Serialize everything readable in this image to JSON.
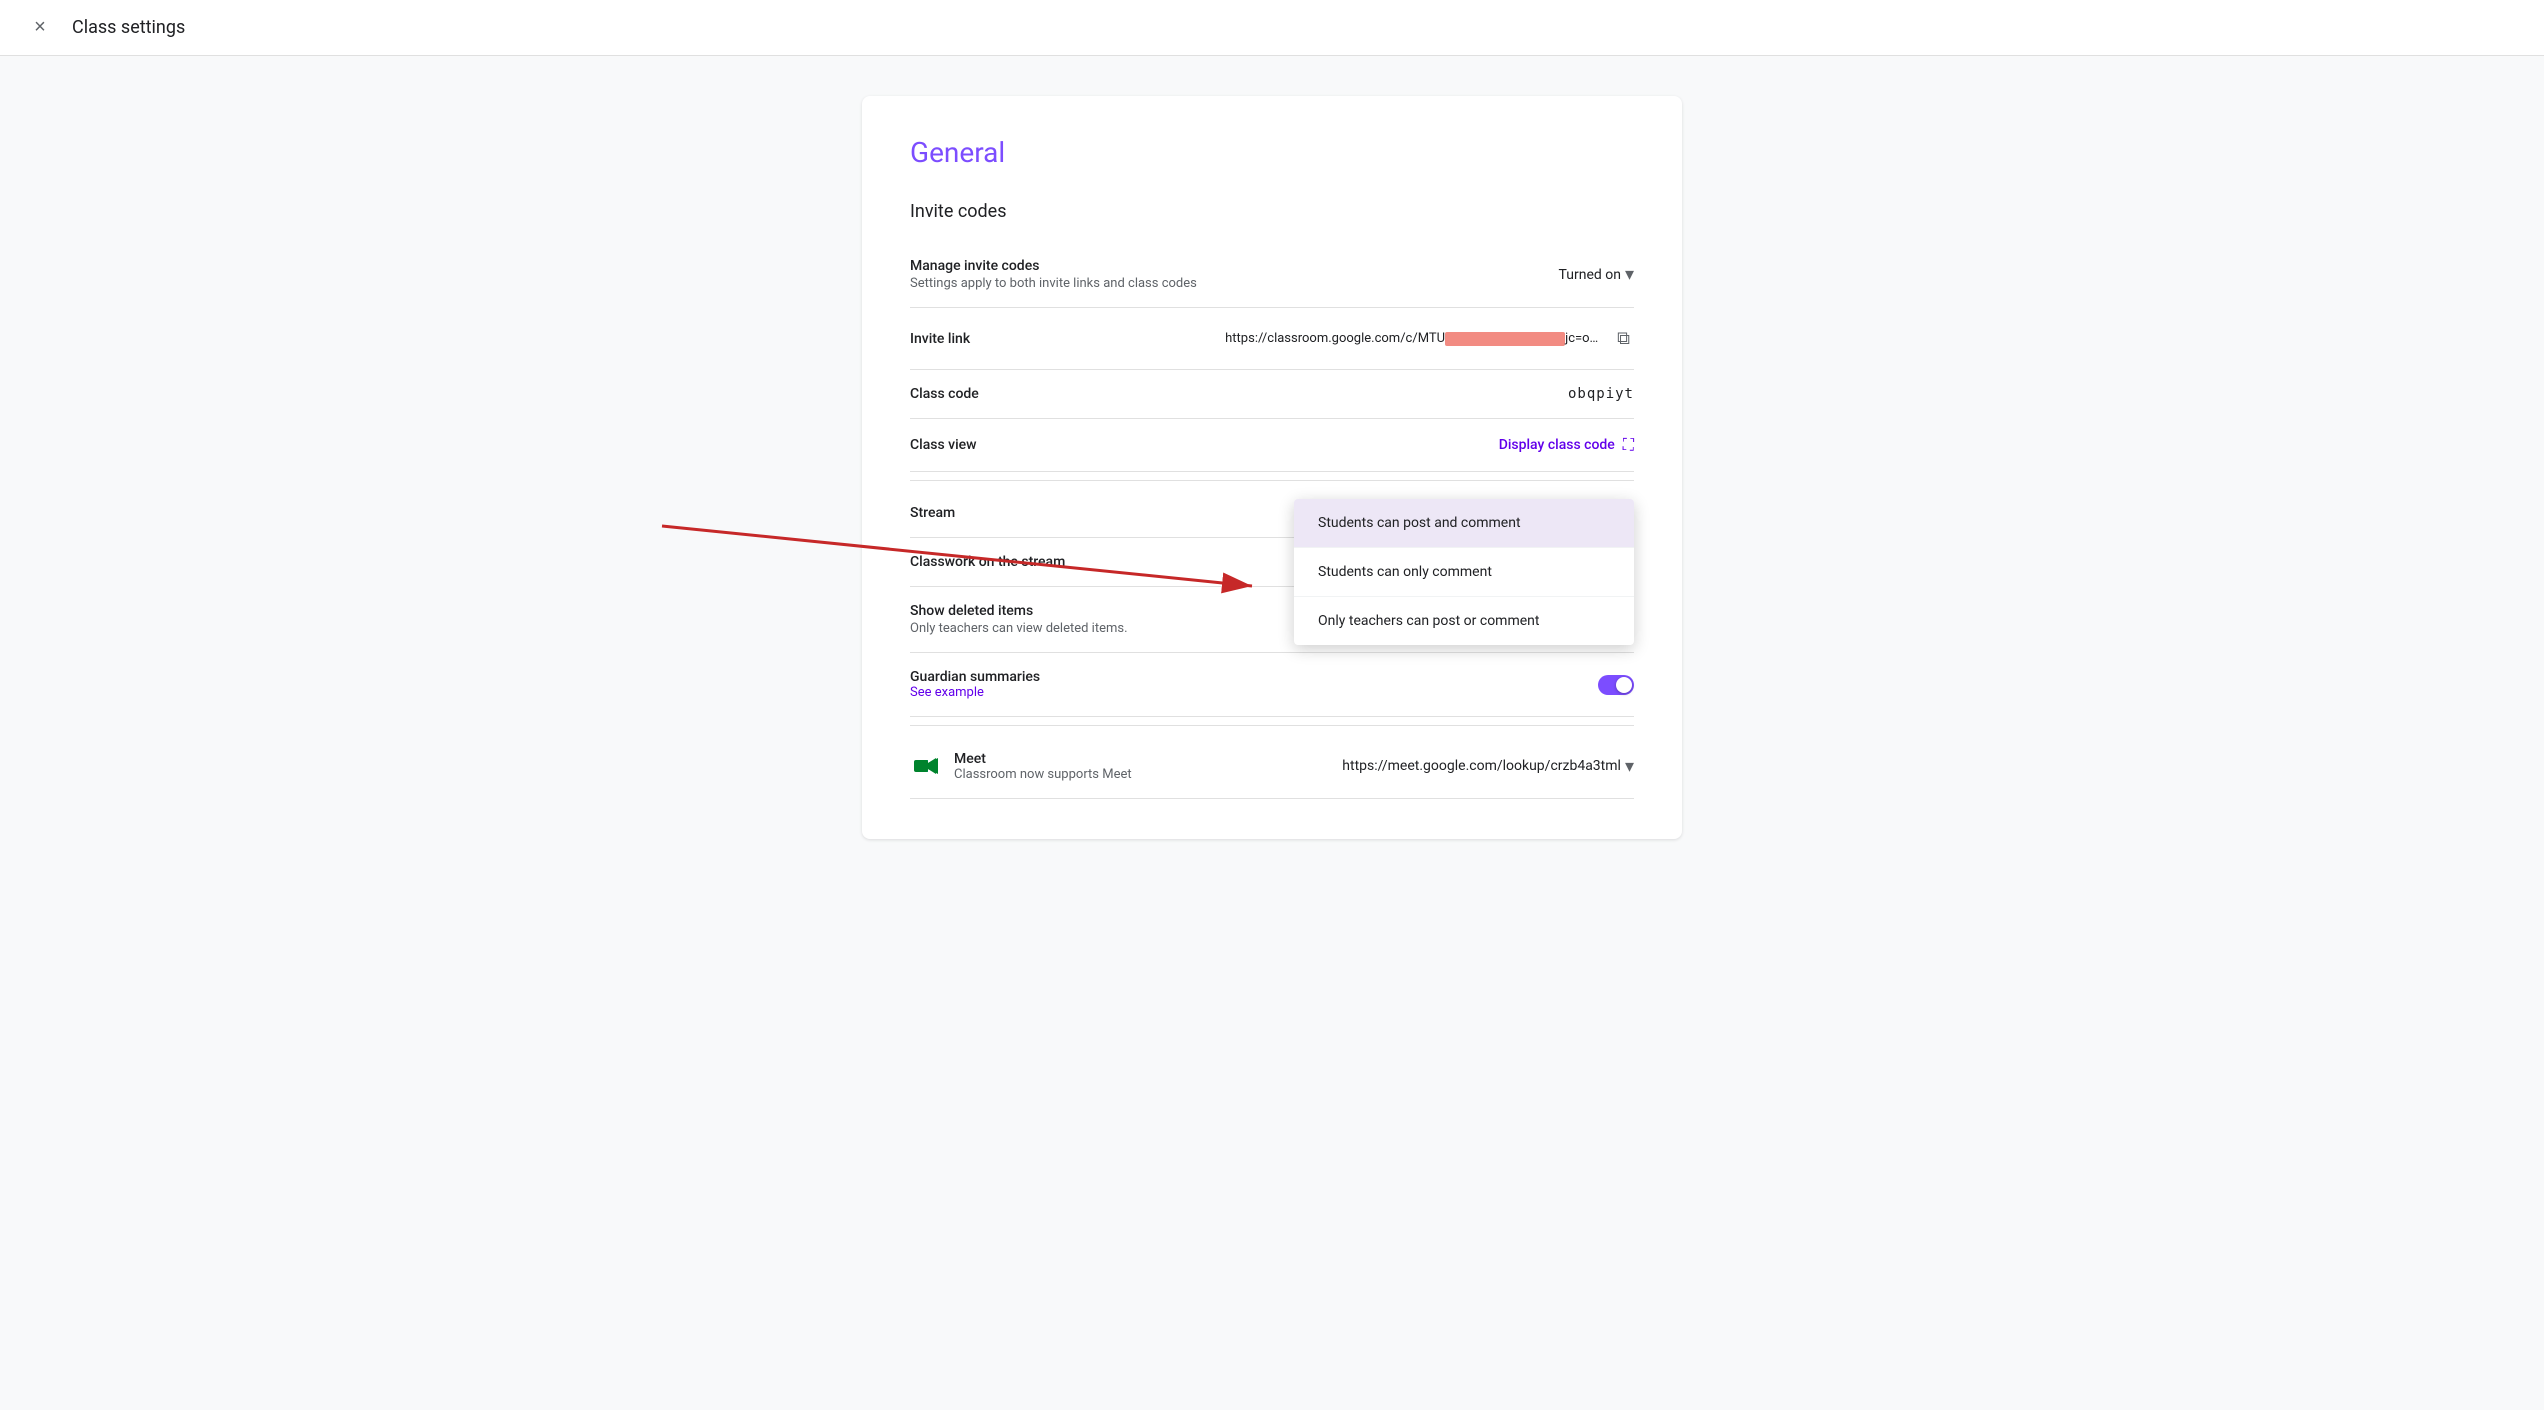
{
  "topbar": {
    "close_label": "×",
    "title": "Class settings"
  },
  "general": {
    "section_title": "General",
    "invite_codes": {
      "section_title": "Invite codes",
      "manage_label": "Manage invite codes",
      "manage_desc": "Settings apply to both invite links and class codes",
      "manage_value": "Turned on",
      "invite_link_label": "Invite link",
      "invite_link_value": "https://classroom.google.com/c/MTU",
      "invite_link_suffix": "jc=obqpiyt",
      "copy_icon": "⧉",
      "class_code_label": "Class code",
      "class_code_value": "obqpiyt",
      "class_view_label": "Class view",
      "display_class_code": "Display class code",
      "expand_icon": "⛶"
    },
    "stream": {
      "label": "Stream",
      "dropdown": {
        "options": [
          "Students can post and comment",
          "Students can only comment",
          "Only teachers can post or comment"
        ],
        "selected": "Students can post and comment"
      }
    },
    "classwork_on_stream": {
      "label": "Classwork on the stream"
    },
    "show_deleted_items": {
      "label": "Show deleted items",
      "desc": "Only teachers can view deleted items.",
      "toggle_state": "off"
    },
    "guardian_summaries": {
      "label": "Guardian summaries",
      "see_example": "See example",
      "toggle_state": "on"
    },
    "meet": {
      "label": "Meet",
      "desc": "Classroom now supports Meet",
      "link": "https://meet.google.com/lookup/crzb4a3tml"
    }
  }
}
